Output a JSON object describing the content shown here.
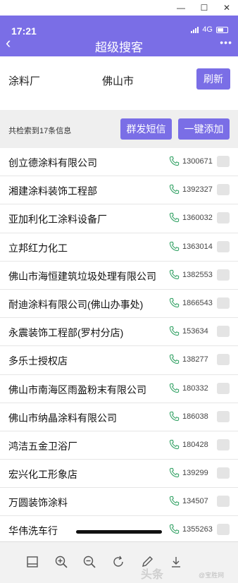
{
  "status": {
    "time": "17:21",
    "network": "4G"
  },
  "header": {
    "title": "超级搜客"
  },
  "search": {
    "keyword": "涂料厂",
    "city": "佛山市",
    "refresh_label": "刷新"
  },
  "results": {
    "count_text": "共检索到17条信息",
    "sms_label": "群发短信",
    "add_label": "一键添加"
  },
  "rows": [
    {
      "name": "创立德涂料有限公司",
      "phone": "1300671"
    },
    {
      "name": "湘建涂料装饰工程部",
      "phone": "1392327"
    },
    {
      "name": "亚加利化工涂料设备厂",
      "phone": "1360032"
    },
    {
      "name": "立邦红力化工",
      "phone": "1363014"
    },
    {
      "name": "佛山市海恒建筑垃圾处理有限公司",
      "phone": "1382553"
    },
    {
      "name": "耐迪涂料有限公司(佛山办事处)",
      "phone": "1866543"
    },
    {
      "name": "永震装饰工程部(罗村分店)",
      "phone": "153634"
    },
    {
      "name": "多乐士授权店",
      "phone": "138277"
    },
    {
      "name": "佛山市南海区雨盈粉末有限公司",
      "phone": "180332"
    },
    {
      "name": "佛山市纳晶涂料有限公司",
      "phone": "186038"
    },
    {
      "name": "鸿洁五金卫浴厂",
      "phone": "180428"
    },
    {
      "name": "宏兴化工形象店",
      "phone": "139299"
    },
    {
      "name": "万圆装饰涂料",
      "phone": "134507"
    },
    {
      "name": "华伟洗车行",
      "phone": "1355263"
    }
  ],
  "watermark": {
    "main": "头条",
    "sub": "@宝胜网"
  },
  "colors": {
    "accent": "#7a6ee6",
    "phone_icon": "#3aa56a"
  }
}
